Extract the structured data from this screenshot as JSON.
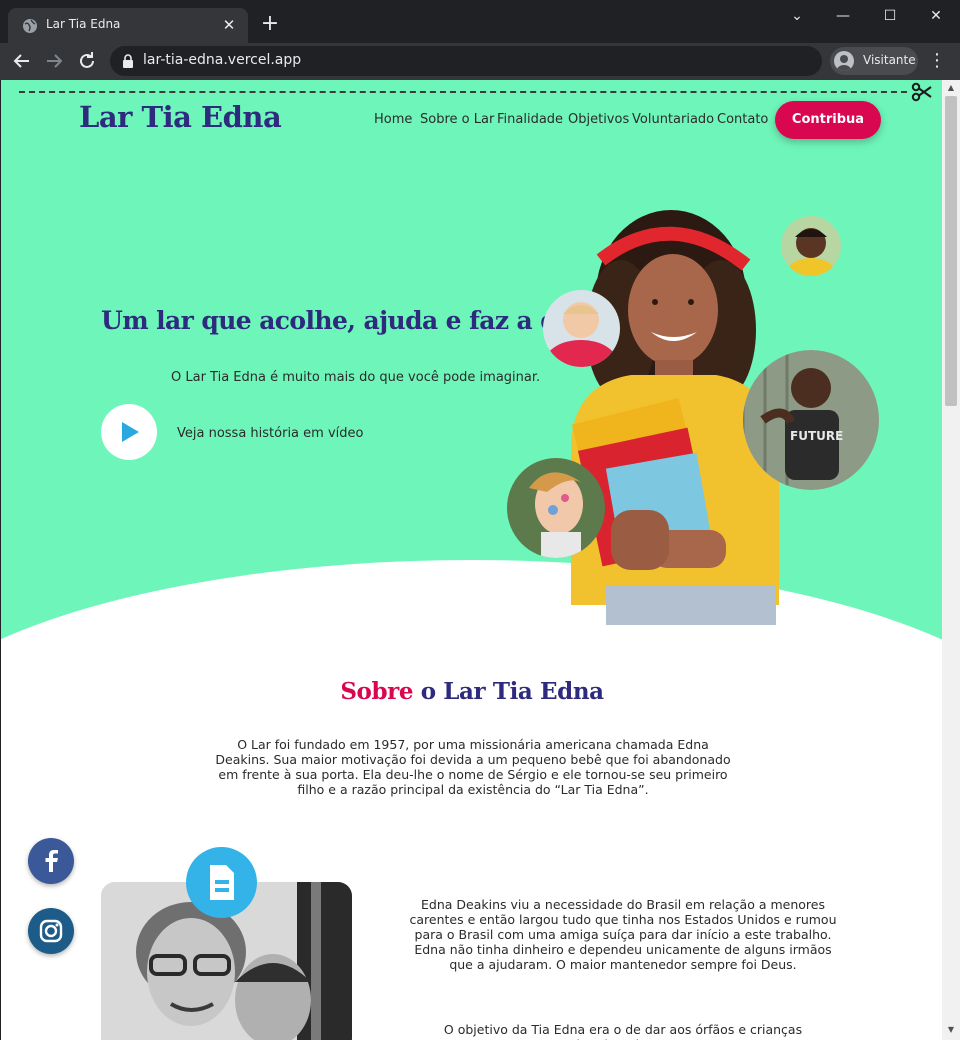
{
  "browser": {
    "tab_title": "Lar Tia Edna",
    "url": "lar-tia-edna.vercel.app",
    "profile_label": "Visitante"
  },
  "site": {
    "logo": "Lar Tia Edna",
    "nav": [
      "Home",
      "Sobre o Lar",
      "Finalidade",
      "Objetivos",
      "Voluntariado",
      "Contato"
    ],
    "cta_label": "Contribua"
  },
  "hero": {
    "title": "Um lar que acolhe, ajuda e faz a diferença",
    "subtitle": "O Lar Tia Edna é muito mais do que você pode imaginar.",
    "video_label": "Veja nossa história em vídeo"
  },
  "about": {
    "title_accent": "Sobre",
    "title_rest": " o Lar Tia Edna",
    "text": "O Lar foi fundado em 1957, por uma missionária americana chamada Edna Deakins. Sua maior motivação foi devida a um pequeno bebê que foi abandonado em frente à sua porta. Ela deu-lhe o nome de Sérgio e ele tornou-se seu primeiro filho e a razão principal da existência do “Lar Tia Edna”."
  },
  "story": {
    "p1": "Edna Deakins viu a necessidade do Brasil em relação a menores carentes e então largou tudo que tinha nos Estados Unidos e rumou para o Brasil com uma amiga suíça para dar início a este trabalho. Edna não tinha dinheiro e dependeu unicamente de alguns irmãos que a ajudaram. O maior mantenedor sempre foi Deus.",
    "p2": "O objetivo da Tia Edna era o de dar aos órfãos e crianças abandonadas um"
  },
  "colors": {
    "hero_bg": "#6ef5b9",
    "brand_navy": "#2e2a7e",
    "brand_pink": "#d8074f",
    "accent_blue": "#33b3e8"
  },
  "icons": [
    "globe-icon",
    "close-icon",
    "plus-icon",
    "back-arrow-icon",
    "forward-arrow-icon",
    "reload-icon",
    "lock-icon",
    "profile-icon",
    "kebab-menu-icon",
    "scissors-icon",
    "play-icon",
    "document-icon",
    "facebook-icon",
    "instagram-icon"
  ]
}
